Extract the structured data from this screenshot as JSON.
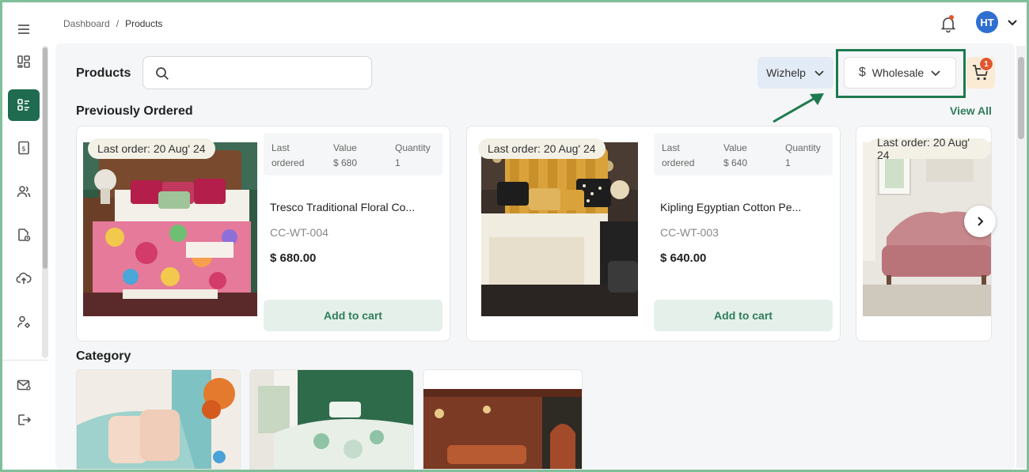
{
  "breadcrumb": {
    "root": "Dashboard",
    "separator": "/",
    "current": "Products"
  },
  "user": {
    "initials": "HT",
    "avatar_color": "#2f6fd0"
  },
  "sidebar": {
    "items": [
      {
        "icon": "dashboard-icon",
        "active": false
      },
      {
        "icon": "products-list-icon",
        "active": true
      },
      {
        "icon": "invoice-icon",
        "active": false
      },
      {
        "icon": "users-icon",
        "active": false
      },
      {
        "icon": "reports-icon",
        "active": false
      },
      {
        "icon": "upload-icon",
        "active": false
      },
      {
        "icon": "user-settings-icon",
        "active": false
      },
      {
        "icon": "mail-icon",
        "active": false
      },
      {
        "icon": "logout-icon",
        "active": false
      }
    ],
    "active_color": "#1e6b4f"
  },
  "header": {
    "title": "Products",
    "search_placeholder": "",
    "brand_selector": "Wizhelp",
    "pricing_selector": {
      "symbol": "$",
      "label": "Wholesale"
    },
    "cart_count": "1"
  },
  "previously_ordered": {
    "title": "Previously Ordered",
    "view_all": "View All",
    "stat_labels": {
      "last_ordered": "Last ordered",
      "value": "Value",
      "quantity": "Quantity"
    },
    "items": [
      {
        "badge": "Last order: 20 Aug' 24",
        "value": "$ 680",
        "quantity": "1",
        "name": "Tresco Traditional Floral Co...",
        "sku": "CC-WT-004",
        "price": "$ 680.00",
        "button": "Add to cart"
      },
      {
        "badge": "Last order: 20 Aug' 24",
        "value": "$ 640",
        "quantity": "1",
        "name": "Kipling Egyptian Cotton Pe...",
        "sku": "CC-WT-003",
        "price": "$ 640.00",
        "button": "Add to cart"
      },
      {
        "badge": "Last order: 20 Aug' 24"
      }
    ]
  },
  "category": {
    "title": "Category"
  },
  "colors": {
    "accent": "#2e7d5b",
    "badge": "#e2572f",
    "highlight": "#1e7a4f"
  }
}
